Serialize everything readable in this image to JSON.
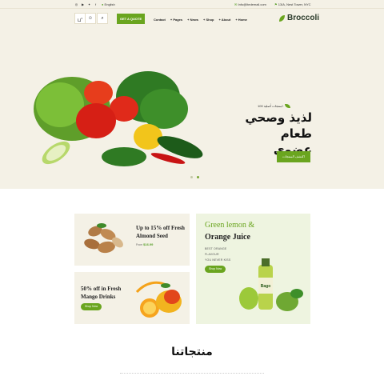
{
  "topbar": {
    "social_icons": [
      "instagram-icon",
      "youtube-icon",
      "twitter-icon",
      "facebook-icon"
    ],
    "language": "English",
    "email": "Info@ltedemail.com",
    "address": "13/A, Nest Tower, NYC"
  },
  "nav": {
    "cart_count": "0",
    "get_quote": "GET A QUOTE",
    "menu": [
      "Contact",
      "+ Pages",
      "+ News",
      "+ Shop",
      "+ About",
      "+ Home"
    ],
    "logo": "Broccoli"
  },
  "hero": {
    "tagline": "منتجات أصلية 100٪",
    "title_line1": "لذيذ وصحي",
    "title_line2": "طعام عضوي",
    "button": "اكتشف المنتجات"
  },
  "promo": {
    "card1": {
      "title_l1": "Up to 15% off Fresh",
      "title_l2": "Almond Seed",
      "from": "From",
      "price": "$16.99"
    },
    "card2": {
      "title_l1": "50% off in Fresh",
      "title_l2": "Mango Drinks",
      "button": "Shop Now"
    },
    "card3": {
      "line1": "Green lemon &",
      "line2": "Orange Juice",
      "l3": "BEST ORANGE",
      "l4": "FLAVOUR",
      "l5": "YOU NEVER KISS",
      "button": "Shop Now"
    }
  },
  "section": {
    "title": "منتجاتنا"
  },
  "colors": {
    "accent": "#6aa51f",
    "cream": "#f4f1e6",
    "mint": "#eef4e0"
  }
}
